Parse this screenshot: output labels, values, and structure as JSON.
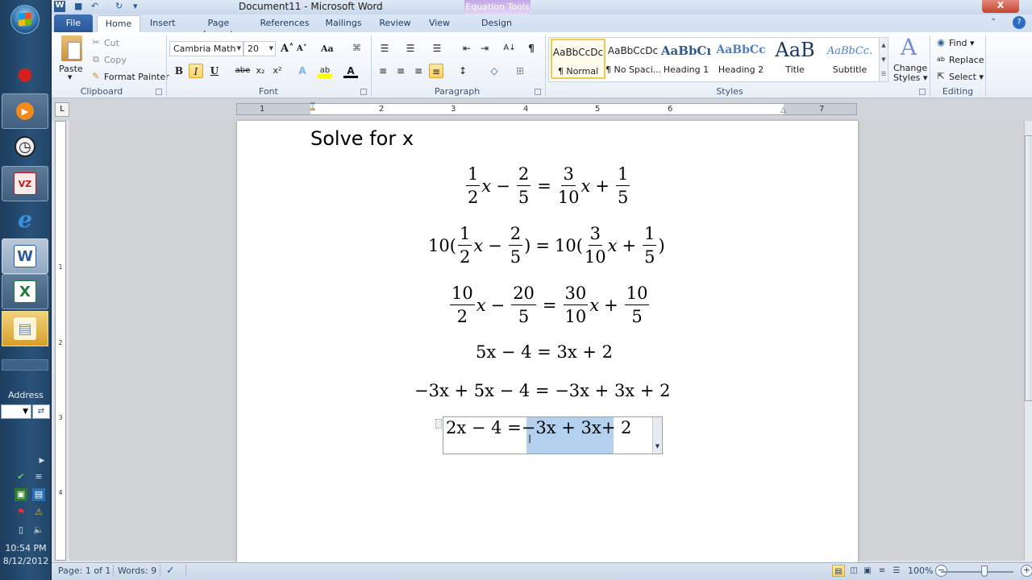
{
  "window": {
    "title": "Document11  -  Microsoft Word",
    "contextual_tab_group": "Equation Tools",
    "close_glyph": "X"
  },
  "quick_access": {
    "word_icon": "W",
    "save_icon": "■",
    "undo_icon": "↶",
    "redo_icon": "↻",
    "customize_icon": "▾"
  },
  "tabs": [
    {
      "label": "File"
    },
    {
      "label": "Home"
    },
    {
      "label": "Insert"
    },
    {
      "label": "Page Layout"
    },
    {
      "label": "References"
    },
    {
      "label": "Mailings"
    },
    {
      "label": "Review"
    },
    {
      "label": "View"
    },
    {
      "label": "Design"
    }
  ],
  "ribbon": {
    "clipboard": {
      "label": "Clipboard",
      "paste": "Paste",
      "cut": "Cut",
      "copy": "Copy",
      "format_painter": "Format Painter"
    },
    "font": {
      "label": "Font",
      "font_name": "Cambria Math",
      "font_size": "20",
      "grow": "A˄",
      "shrink": "A˅",
      "change_case": "Aa",
      "clear": "⌘",
      "bold": "B",
      "italic": "I",
      "underline": "U",
      "strike": "abe",
      "subscript": "x₂",
      "superscript": "x²",
      "text_effects": "A",
      "highlight": "ab",
      "font_color": "A"
    },
    "paragraph": {
      "label": "Paragraph",
      "bullets": "☰",
      "numbering": "☰",
      "multilevel": "☰",
      "decrease_indent": "⇤",
      "increase_indent": "⇥",
      "sort": "A↓",
      "show_marks": "¶",
      "align_left": "≡",
      "center": "≡",
      "align_right": "≡",
      "justify": "≡",
      "line_spacing": "↕",
      "shading": "◇",
      "borders": "⊞"
    },
    "styles": {
      "label": "Styles",
      "items": [
        {
          "preview": "AaBbCcDc",
          "name": "¶ Normal",
          "selected": true
        },
        {
          "preview": "AaBbCcDc",
          "name": "¶ No Spaci...",
          "selected": false
        },
        {
          "preview": "AaBbCı",
          "name": "Heading 1",
          "selected": false
        },
        {
          "preview": "AaBbCc",
          "name": "Heading 2",
          "selected": false
        },
        {
          "preview": "AaB",
          "name": "Title",
          "selected": false
        },
        {
          "preview": "AaBbCc.",
          "name": "Subtitle",
          "selected": false
        }
      ],
      "change_styles_line1": "Change",
      "change_styles_line2": "Styles ▾"
    },
    "editing": {
      "label": "Editing",
      "find": "Find ▾",
      "replace": "Replace",
      "select": "Select ▾"
    }
  },
  "ruler": {
    "numbers": [
      "1",
      "1",
      "2",
      "3",
      "4",
      "5",
      "6",
      "7"
    ],
    "tab_selector": "L",
    "vertical_numbers": [
      "1",
      "2",
      "3",
      "4"
    ]
  },
  "document": {
    "heading": "Solve for x",
    "lines": {
      "l1": {
        "a_n": "1",
        "a_d": "2",
        "b_n": "2",
        "b_d": "5",
        "c_n": "3",
        "c_d": "10",
        "d_n": "1",
        "d_d": "5"
      },
      "l2": {
        "k1": "10",
        "a_n": "1",
        "a_d": "2",
        "b_n": "2",
        "b_d": "5",
        "k2": "10",
        "c_n": "3",
        "c_d": "10",
        "d_n": "1",
        "d_d": "5"
      },
      "l3": {
        "a_n": "10",
        "a_d": "2",
        "b_n": "20",
        "b_d": "5",
        "c_n": "30",
        "c_d": "10",
        "d_n": "10",
        "d_d": "5"
      },
      "l4": "5x − 4 = 3x + 2",
      "l5": "−3x + 5x − 4 = −3x + 3x + 2",
      "l6_pre": "2x − 4 = ",
      "l6_sel": "−3x + 3x",
      "l6_post": " + 2"
    },
    "var": "x",
    "ops": {
      "minus": "−",
      "plus": "+",
      "eq": "=",
      "lp": "(",
      "rp": ")"
    }
  },
  "statusbar": {
    "page": "Page: 1 of 1",
    "words": "Words: 9",
    "proofing_icon": "✓",
    "zoom": "100%",
    "zoom_minus": "−",
    "zoom_plus": "+",
    "zoom_percent": 100
  },
  "taskbar": {
    "address_label": "Address",
    "address_go": "⇄",
    "time": "10:54 PM",
    "date": "8/12/2012",
    "pinned": [
      {
        "name": "media-player",
        "glyph": "▶"
      },
      {
        "name": "clock",
        "glyph": "◷"
      },
      {
        "name": "pdf-app",
        "glyph": "VZ"
      },
      {
        "name": "internet-explorer",
        "glyph": "e"
      },
      {
        "name": "word",
        "glyph": "W"
      },
      {
        "name": "excel",
        "glyph": "X"
      },
      {
        "name": "file-explorer",
        "glyph": "▤"
      }
    ]
  },
  "colors": {
    "accent_blue": "#2a579a",
    "selection": "#b3d1ee",
    "active_highlight": "#f8d46b",
    "equation_tools": "#c3a8e6"
  }
}
